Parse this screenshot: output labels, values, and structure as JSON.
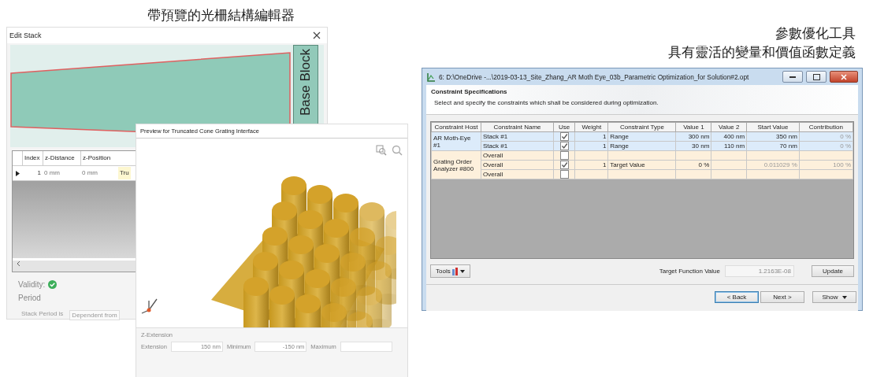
{
  "captions": {
    "left": "帶預覽的光柵結構編輯器",
    "right": [
      "參數優化工具",
      "具有靈活的變量和價值函數定義"
    ]
  },
  "edit_stack": {
    "title": "Edit Stack",
    "block_label": "Base Block",
    "columns": [
      "Index",
      "z-Distance",
      "z-Position"
    ],
    "rows": [
      {
        "selected": true,
        "cells": [
          "1",
          "0 mm",
          "0 mm",
          "Tru"
        ]
      }
    ],
    "validity_label": "Validity:",
    "valid": true,
    "period_label": "Period",
    "stack_period_label": "Stack Period is",
    "stack_period_value": "Dependent from"
  },
  "preview": {
    "title": "Preview for Truncated Cone Grating Interface",
    "section": "Z-Extension",
    "fields": [
      {
        "label": "Extension",
        "value": "150 nm"
      },
      {
        "label": "Minimum",
        "value": "-150 nm"
      },
      {
        "label": "Maximum"
      }
    ]
  },
  "optimization": {
    "title": "6: D:\\OneDrive -...\\2019-03-13_Site_Zhang_AR Moth Eye_03b_Parametric Optimization_for Solution#2.opt",
    "heading": "Constraint Specifications",
    "subtitle": "Select and specify the constraints which shall be considered during optimization.",
    "columns": [
      "Constraint Host",
      "Constraint Name",
      "Use",
      "Weight",
      "Constraint Type",
      "Value 1",
      "Value 2",
      "Start Value",
      "Contribution"
    ],
    "groups": [
      {
        "host": "AR Moth-Eye #1",
        "color": "#dcebfa",
        "rows": [
          {
            "name": "Stack #1",
            "use": true,
            "weight": "1",
            "type": "Range",
            "value_1": "300 nm",
            "value_2": "400 nm",
            "start": "350 nm",
            "contribution": "0 %"
          },
          {
            "name": "Stack #1",
            "use": true,
            "weight": "1",
            "type": "Range",
            "value_1": "30 nm",
            "value_2": "110 nm",
            "start": "70 nm",
            "contribution": "0 %"
          }
        ]
      },
      {
        "host": "Grating Order Analyzer #800",
        "color": "#fdf0dc",
        "rows": [
          {
            "name": "Overall",
            "use": false,
            "weight": "",
            "type": "",
            "value_1": "",
            "value_2": "",
            "start": "",
            "contribution": ""
          },
          {
            "name": "Overall",
            "use": true,
            "weight": "1",
            "type": "Target Value",
            "value_1": "0 %",
            "value_2": "",
            "start": "0.011029 %",
            "contribution": "100 %"
          },
          {
            "name": "Overall",
            "use": false,
            "weight": "",
            "type": "",
            "value_1": "",
            "value_2": "",
            "start": "",
            "contribution": ""
          }
        ]
      }
    ],
    "tools_label": "Tools",
    "target_label": "Target Function Value",
    "target_value": "1.2163E-08",
    "update_label": "Update",
    "nav": [
      {
        "label": "< Back",
        "selected": true
      },
      {
        "label": "Next >",
        "selected": false
      },
      {
        "label": "Show",
        "selected": false,
        "dropdown": true
      }
    ]
  }
}
